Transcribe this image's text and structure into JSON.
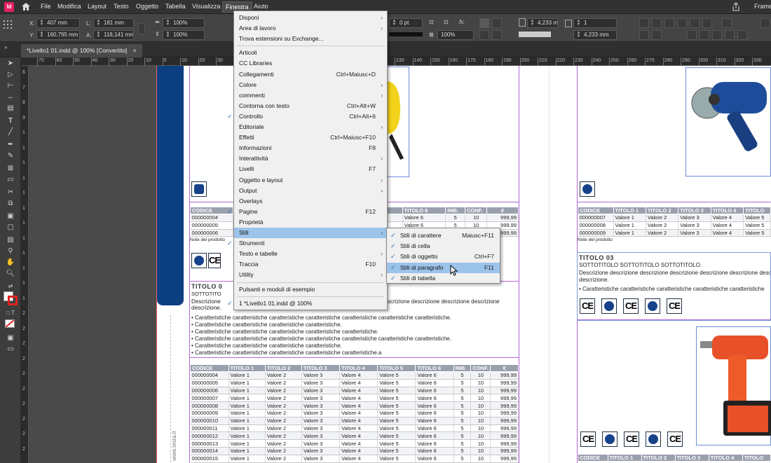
{
  "menubar": {
    "app_icon": "Id",
    "items": [
      "File",
      "Modifica",
      "Layout",
      "Testo",
      "Oggetto",
      "Tabella",
      "Visualizza",
      "Finestra",
      "Aiuto"
    ],
    "right_label": "Frame"
  },
  "control": {
    "x_label": "X:",
    "x_value": "407 mm",
    "y_label": "Y:",
    "y_value": "160,795 mm",
    "w_label": "L:",
    "w_value": "181 mm",
    "h_label": "A:",
    "h_value": "118,141 mm",
    "scale_x": "100%",
    "scale_y": "100%",
    "stroke_weight": "0 pt",
    "opacity": "100%",
    "offset_a": "4,233 mm",
    "offset_b": "4,233 mm",
    "columns": "1"
  },
  "tab": {
    "title": "*Livello1 01.indd @ 100% [Convertito]",
    "close": "×"
  },
  "ruler_ticks_h": [
    "70",
    "60",
    "50",
    "40",
    "30",
    "20",
    "10",
    "0",
    "10",
    "20",
    "30",
    "40",
    "50",
    "60",
    "70",
    "80",
    "90",
    "100",
    "110",
    "120",
    "130",
    "140",
    "150",
    "160",
    "170",
    "180",
    "190",
    "200",
    "210",
    "220",
    "230",
    "240",
    "250",
    "260",
    "270",
    "280",
    "290",
    "300",
    "310",
    "320",
    "330"
  ],
  "ruler_ticks_v": [
    "6",
    "7",
    "8",
    "9",
    "1",
    "1",
    "1",
    "1",
    "1",
    "1",
    "1",
    "1",
    "1",
    "1",
    "1",
    "1",
    "2",
    "2",
    "2",
    "2",
    "2",
    "2",
    "2",
    "2",
    "2",
    "2"
  ],
  "menu": {
    "items": [
      {
        "label": "Disponi",
        "shortcut": "",
        "arrow": true,
        "check": false
      },
      {
        "label": "Area di lavoro",
        "shortcut": "",
        "arrow": true,
        "check": false
      },
      {
        "label": "Trova estensioni su Exchange...",
        "shortcut": "",
        "arrow": false,
        "check": false
      },
      {
        "label": "Articoli",
        "shortcut": "",
        "arrow": false,
        "check": false,
        "sep": true
      },
      {
        "label": "CC Libraries",
        "shortcut": "",
        "arrow": false,
        "check": false
      },
      {
        "label": "Collegamenti",
        "shortcut": "Ctrl+Maiusc+D",
        "arrow": false,
        "check": false
      },
      {
        "label": "Colore",
        "shortcut": "",
        "arrow": true,
        "check": false
      },
      {
        "label": "commenti",
        "shortcut": "",
        "arrow": true,
        "check": false
      },
      {
        "label": "Contorna con testo",
        "shortcut": "Ctrl+Alt+W",
        "arrow": false,
        "check": false
      },
      {
        "label": "Controllo",
        "shortcut": "Ctrl+Alt+6",
        "arrow": false,
        "check": true
      },
      {
        "label": "Editoriale",
        "shortcut": "",
        "arrow": true,
        "check": false
      },
      {
        "label": "Effetti",
        "shortcut": "Ctrl+Maiusc+F10",
        "arrow": false,
        "check": false
      },
      {
        "label": "Informazioni",
        "shortcut": "F8",
        "arrow": false,
        "check": false
      },
      {
        "label": "Interattività",
        "shortcut": "",
        "arrow": true,
        "check": false
      },
      {
        "label": "Livelli",
        "shortcut": "F7",
        "arrow": false,
        "check": false
      },
      {
        "label": "Oggetto e layout",
        "shortcut": "",
        "arrow": true,
        "check": false
      },
      {
        "label": "Output",
        "shortcut": "",
        "arrow": true,
        "check": false
      },
      {
        "label": "Overlays",
        "shortcut": "",
        "arrow": false,
        "check": false
      },
      {
        "label": "Pagine",
        "shortcut": "F12",
        "arrow": false,
        "check": true
      },
      {
        "label": "Proprietà",
        "shortcut": "",
        "arrow": false,
        "check": false
      },
      {
        "label": "Stili",
        "shortcut": "",
        "arrow": true,
        "check": false,
        "highlight": true
      },
      {
        "label": "Strumenti",
        "shortcut": "",
        "arrow": false,
        "check": true
      },
      {
        "label": "Testo e tabelle",
        "shortcut": "",
        "arrow": true,
        "check": false
      },
      {
        "label": "Traccia",
        "shortcut": "F10",
        "arrow": false,
        "check": false
      },
      {
        "label": "Utility",
        "shortcut": "",
        "arrow": true,
        "check": false
      },
      {
        "label": "Pulsanti e moduli di esempio",
        "shortcut": "",
        "arrow": false,
        "check": false,
        "sep": true
      },
      {
        "label": "1 *Livello1 01.indd @ 100%",
        "shortcut": "",
        "arrow": false,
        "check": true,
        "sep": true
      }
    ]
  },
  "submenu": {
    "items": [
      {
        "label": "Stili di carattere",
        "shortcut": "Maiusc+F11",
        "check": true
      },
      {
        "label": "Stili di cella",
        "shortcut": "",
        "check": true
      },
      {
        "label": "Stili di oggetto",
        "shortcut": "Ctrl+F7",
        "check": true
      },
      {
        "label": "Stili di paragrafo",
        "shortcut": "F11",
        "check": true,
        "highlight": true
      },
      {
        "label": "Stili di tabella",
        "shortcut": "",
        "check": true
      }
    ]
  },
  "page1": {
    "top_table_header": [
      "CODICE",
      "",
      "",
      "",
      "TITOLO 5",
      "TITOLO 6",
      "IMB.",
      "CONF.",
      "€"
    ],
    "top_table_rows": [
      [
        "000000004",
        "",
        "",
        "",
        "Valore 5",
        "Valore 6",
        "5",
        "10",
        "999,99"
      ],
      [
        "000000005",
        "",
        "",
        "",
        "Valore 5",
        "Valore 6",
        "5",
        "10",
        "999,99"
      ],
      [
        "000000006",
        "",
        "",
        "",
        "Valore 5",
        "Valore 6",
        "5",
        "10",
        "999,99"
      ]
    ],
    "note": "Note del prodotto",
    "title": "TITOLO 0",
    "subtitle": "SOTTOTITO",
    "description_1": "Descrizione",
    "description_tail": "scrizione descrizione descrizione descrizione",
    "description_2": "descrizione.",
    "bullets": [
      "Caratteristiche caratteristiche caratteristiche caratteristiche caratteristiche caratteristiche caratteristiche.",
      "Caratteristiche caratteristiche caratteristiche caratteristiche.",
      "Caratteristiche caratteristiche caratteristiche caratteristiche caratteristiche.",
      "Caratteristiche caratteristiche caratteristiche caratteristiche caratteristiche caratteristiche caratteristiche.",
      "Caratteristiche caratteristiche caratteristiche caratteristiche.",
      "Caratteristiche caratteristiche caratteristiche caratteristiche caratteristiche.a"
    ],
    "table_header": [
      "CODICE",
      "TITOLO 1",
      "TITOLO 2",
      "TITOLO 3",
      "TITOLO 4",
      "TITOLO 5",
      "TITOLO 6",
      "IMB.",
      "CONF.",
      "€"
    ],
    "table_rows": [
      [
        "000000004",
        "Valore 1",
        "Valore 2",
        "Valore 3",
        "Valore 4",
        "Valore 5",
        "Valore 6",
        "5",
        "10",
        "999,99"
      ],
      [
        "000000005",
        "Valore 1",
        "Valore 2",
        "Valore 3",
        "Valore 4",
        "Valore 5",
        "Valore 6",
        "5",
        "10",
        "999,99"
      ],
      [
        "000000006",
        "Valore 1",
        "Valore 2",
        "Valore 3",
        "Valore 4",
        "Valore 5",
        "Valore 6",
        "5",
        "10",
        "999,99"
      ],
      [
        "000000007",
        "Valore 1",
        "Valore 2",
        "Valore 3",
        "Valore 4",
        "Valore 5",
        "Valore 6",
        "5",
        "10",
        "999,99"
      ],
      [
        "000000008",
        "Valore 1",
        "Valore 2",
        "Valore 3",
        "Valore 4",
        "Valore 5",
        "Valore 6",
        "5",
        "10",
        "999,99"
      ],
      [
        "000000009",
        "Valore 1",
        "Valore 2",
        "Valore 3",
        "Valore 4",
        "Valore 5",
        "Valore 6",
        "5",
        "10",
        "999,99"
      ],
      [
        "000000010",
        "Valore 1",
        "Valore 2",
        "Valore 3",
        "Valore 4",
        "Valore 5",
        "Valore 6",
        "5",
        "10",
        "999,99"
      ],
      [
        "000000011",
        "Valore 1",
        "Valore 2",
        "Valore 3",
        "Valore 4",
        "Valore 5",
        "Valore 6",
        "5",
        "10",
        "999,99"
      ],
      [
        "000000012",
        "Valore 1",
        "Valore 2",
        "Valore 3",
        "Valore 4",
        "Valore 5",
        "Valore 6",
        "5",
        "10",
        "999,99"
      ],
      [
        "000000013",
        "Valore 1",
        "Valore 2",
        "Valore 3",
        "Valore 4",
        "Valore 5",
        "Valore 6",
        "5",
        "10",
        "999,99"
      ],
      [
        "000000014",
        "Valore 1",
        "Valore 2",
        "Valore 3",
        "Valore 4",
        "Valore 5",
        "Valore 6",
        "5",
        "10",
        "999,99"
      ],
      [
        "000000015",
        "Valore 1",
        "Valore 2",
        "Valore 3",
        "Valore 4",
        "Valore 5",
        "Valore 6",
        "5",
        "10",
        "999,99"
      ]
    ],
    "sidebar_text": "www.testa.it"
  },
  "page2": {
    "top_table_header": [
      "CODICE",
      "TITOLO 1",
      "TITOLO 2",
      "TITOLO 3",
      "TITOLO 4",
      "TITOLO"
    ],
    "top_table_rows": [
      [
        "000000007",
        "Valore 1",
        "Valore 2",
        "Valore 3",
        "Valore 4",
        "Valore 5"
      ],
      [
        "000000008",
        "Valore 1",
        "Valore 2",
        "Valore 3",
        "Valore 4",
        "Valore 5"
      ],
      [
        "000000009",
        "Valore 1",
        "Valore 2",
        "Valore 3",
        "Valore 4",
        "Valore 5"
      ]
    ],
    "note": "Note del prodotto",
    "title": "TITOLO 03",
    "subtitle": "SOTTOTITOLO SOTTOTITOLO SOTTOTITOLO.",
    "description_1": "Descrizione descrizione descrizione descrizione descrizione descrizione desc",
    "description_2": "descrizione.",
    "bullet": "Caratteristiche caratteristiche caratteristiche caratteristiche caratteristiche",
    "bottom_header": [
      "CODICE",
      "TITOLO 1",
      "TITOLO 2",
      "TITOLO 3",
      "TITOLO 4",
      "TITOLO"
    ]
  },
  "cert": {
    "ce": "CE",
    "tuv": "TÜV"
  },
  "colors": {
    "accent_blue": "#0b3f82",
    "menu_highlight": "#9cc3ea",
    "guide": "#b267d6",
    "table_header": "#9aa0ad"
  }
}
